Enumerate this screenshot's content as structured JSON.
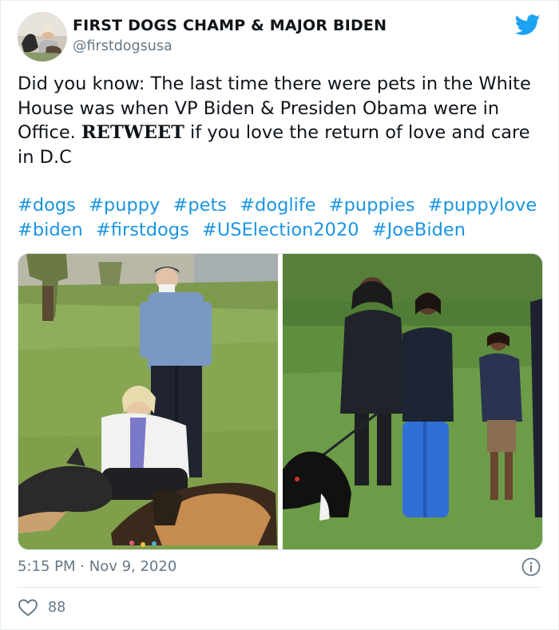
{
  "author": {
    "display_name": "FIRST DOGS CHAMP & MAJOR BIDEN",
    "handle": "@firstdogsusa"
  },
  "tweet": {
    "text_before": "Did you know: The last time there were pets in the White House was when VP Biden & Presiden Obama were in Office. ",
    "text_emphasis": "RETWEET",
    "text_after": " if you love the return of love and care in D.C",
    "hashtags": [
      "#dogs",
      "#puppy",
      "#pets",
      "#doglife",
      "#puppies",
      "#puppylove",
      "#biden",
      "#firstdogs",
      "#USElection2020",
      "#JoeBiden"
    ]
  },
  "meta": {
    "time": "5:15 PM",
    "separator": "·",
    "date": "Nov 9, 2020",
    "likes": "88"
  },
  "icons": {
    "brand": "twitter-bird-icon",
    "info": "info-icon",
    "like": "heart-icon"
  },
  "colors": {
    "brand": "#1da1f2",
    "link": "#1b95e0",
    "secondary_text": "#657786"
  }
}
